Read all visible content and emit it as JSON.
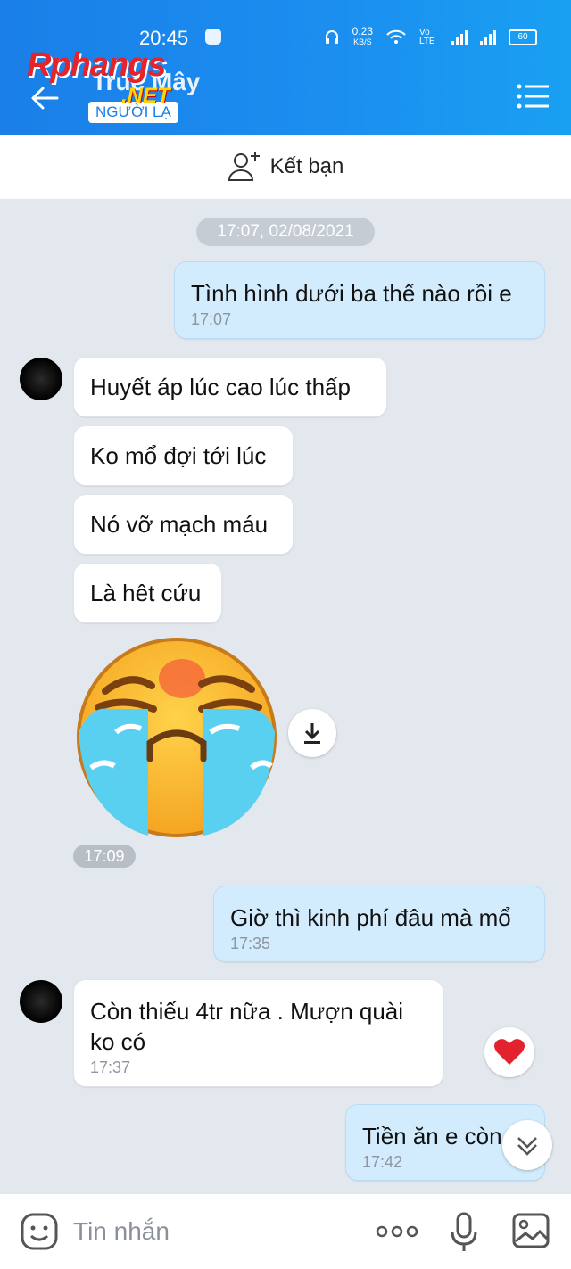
{
  "status_bar": {
    "time": "20:45",
    "speed_value": "0.23",
    "speed_unit": "KB/S",
    "network": "Vo LTE",
    "battery": "60"
  },
  "header": {
    "contact_name": "Trúc Mây",
    "badge": "NGƯỜI LẠ",
    "watermark": "Rphangs",
    "watermark_sub": ".NET"
  },
  "add_friend": {
    "label": "Kết bạn"
  },
  "chat": {
    "date": "17:07, 02/08/2021",
    "messages": [
      {
        "dir": "out",
        "text": "Tình hình dưới ba thế nào rồi e",
        "time": "17:07"
      },
      {
        "dir": "in",
        "text": "Huyết áp lúc cao lúc thấp"
      },
      {
        "dir": "in",
        "text": "Ko mổ đợi tới lúc"
      },
      {
        "dir": "in",
        "text": "Nó vỡ mạch máu"
      },
      {
        "dir": "in",
        "text": "Là hêt cứu"
      },
      {
        "dir": "out",
        "text": "Giờ thì kinh phí đâu mà mổ",
        "time": "17:35"
      },
      {
        "dir": "in",
        "text": "Còn thiếu 4tr nữa . Mượn quài ko có",
        "time": "17:37"
      },
      {
        "dir": "out",
        "text": "Tiền ăn e còn",
        "time": "17:42"
      }
    ],
    "sticker_time": "17:09"
  },
  "composer": {
    "placeholder": "Tin nhắn"
  },
  "colors": {
    "header_blue": "#1a7fe8",
    "outgoing_bubble": "#d3ecfd",
    "background": "#e3e8ef"
  }
}
